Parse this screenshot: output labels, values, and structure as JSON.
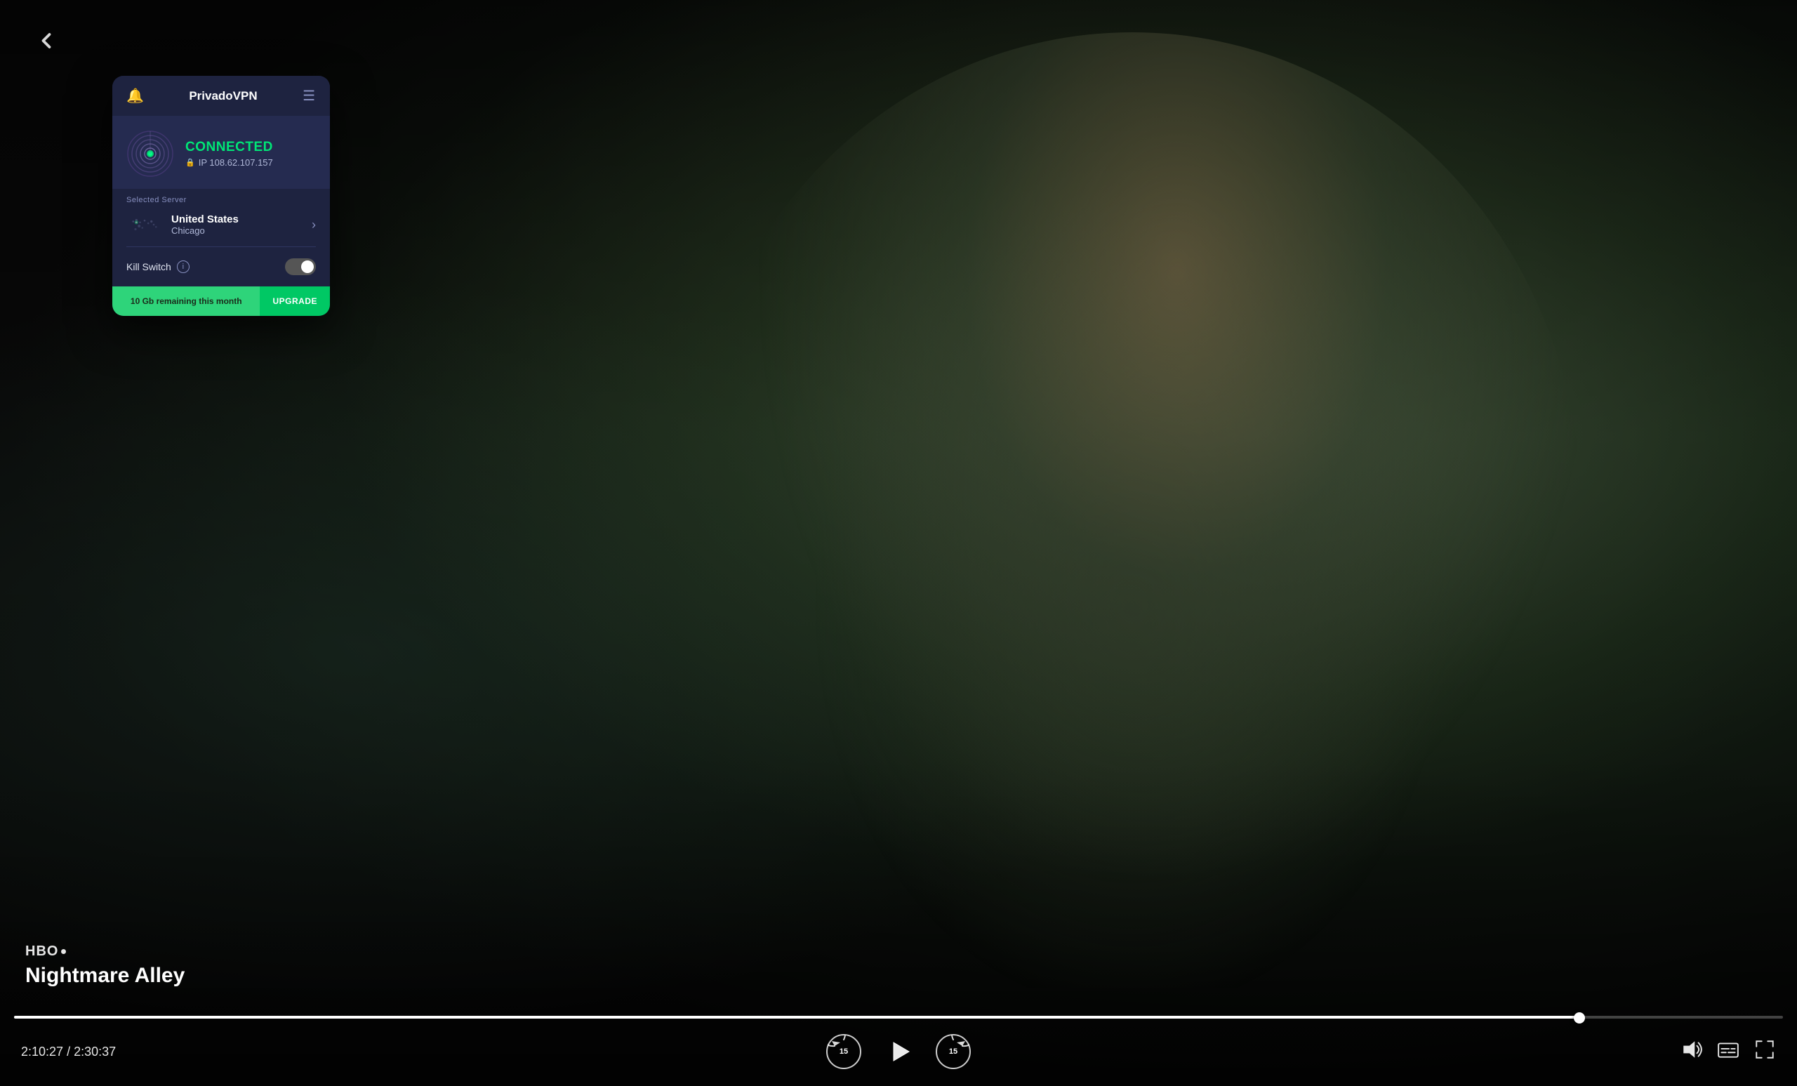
{
  "app": {
    "title": "PrivadoVPN",
    "back_label": "back"
  },
  "vpn": {
    "header": {
      "title": "PrivadoVPN",
      "bell_icon": "bell-icon",
      "menu_icon": "menu-icon"
    },
    "connection": {
      "status": "CONNECTED",
      "ip_label": "IP",
      "ip_address": "108.62.107.157"
    },
    "server": {
      "section_label": "Selected Server",
      "country": "United States",
      "city": "Chicago"
    },
    "kill_switch": {
      "label": "Kill Switch",
      "info_symbol": "i",
      "enabled": false
    },
    "footer": {
      "remaining_text": "10 Gb remaining this month",
      "upgrade_label": "UPGRADE"
    }
  },
  "video": {
    "hbo_label": "HBO",
    "title": "Nightmare Alley",
    "time_current": "2:10:27",
    "time_total": "2:30:37",
    "time_separator": "/",
    "progress_percent": 88.5,
    "controls": {
      "rewind_label": "15",
      "play_label": "play",
      "forward_label": "15"
    }
  }
}
